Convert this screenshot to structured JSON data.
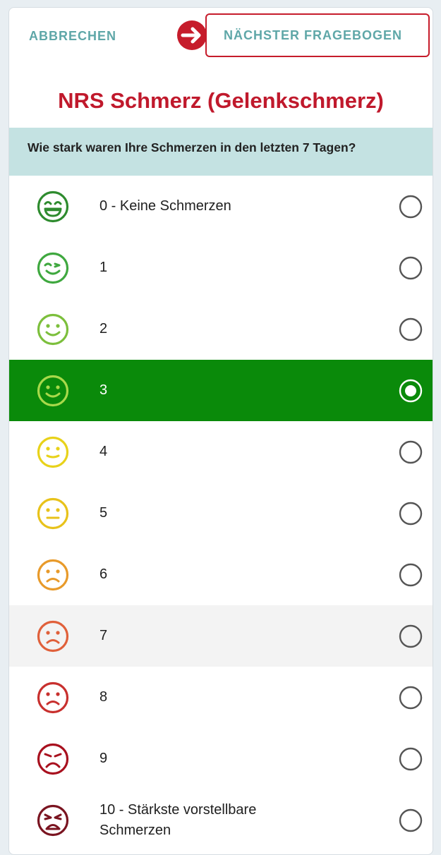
{
  "topbar": {
    "cancel_label": "ABBRECHEN",
    "next_label": "NÄCHSTER FRAGEBOGEN"
  },
  "title": "NRS Schmerz (Gelenkschmerz)",
  "question": "Wie stark waren Ihre Schmerzen in den letzten 7 Tagen?",
  "selected_value": 3,
  "options": [
    {
      "label": "0 - Keine Schmerzen",
      "face_color": "#2e8b2e",
      "mood": "laugh"
    },
    {
      "label": "1",
      "face_color": "#3fa83f",
      "mood": "wink"
    },
    {
      "label": "2",
      "face_color": "#7cbf3c",
      "mood": "smile"
    },
    {
      "label": "3",
      "face_color": "#a8d94a",
      "mood": "smile"
    },
    {
      "label": "4",
      "face_color": "#e8d21a",
      "mood": "slight"
    },
    {
      "label": "5",
      "face_color": "#e8c21a",
      "mood": "neutral"
    },
    {
      "label": "6",
      "face_color": "#e89a2a",
      "mood": "sad"
    },
    {
      "label": "7",
      "face_color": "#e0603a",
      "mood": "sad"
    },
    {
      "label": "8",
      "face_color": "#c8302e",
      "mood": "sad"
    },
    {
      "label": "9",
      "face_color": "#a8101e",
      "mood": "frown"
    },
    {
      "label": "10 - Stärkste vorstellbare Schmerzen",
      "face_color": "#7a1420",
      "mood": "cry"
    }
  ],
  "colors": {
    "accent": "#c0192c",
    "button_text": "#5fa7a8",
    "question_bg": "#c4e2e2",
    "selected_bg": "#0a8a0a"
  }
}
